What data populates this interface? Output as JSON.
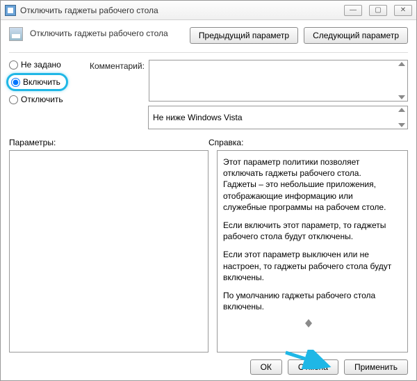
{
  "window": {
    "title": "Отключить гаджеты рабочего стола",
    "min_glyph": "—",
    "max_glyph": "▢",
    "close_glyph": "✕"
  },
  "header": {
    "title": "Отключить гаджеты рабочего стола",
    "prev": "Предыдущий параметр",
    "next": "Следующий параметр"
  },
  "radios": {
    "not_configured": "Не задано",
    "enabled": "Включить",
    "disabled": "Отключить",
    "selected": "enabled"
  },
  "comment": {
    "label": "Комментарий:",
    "value": ""
  },
  "supported": {
    "value": "Не ниже Windows Vista"
  },
  "sections": {
    "params": "Параметры:",
    "help": "Справка:"
  },
  "help": {
    "p1": "Этот параметр политики позволяет отключать гаджеты рабочего стола. Гаджеты – это небольшие приложения, отображающие информацию или служебные программы на рабочем столе.",
    "p2": "Если включить этот параметр, то гаджеты рабочего стола будут отключены.",
    "p3": "Если этот параметр выключен или не настроен, то гаджеты рабочего стола будут включены.",
    "p4": "По умолчанию гаджеты рабочего стола включены."
  },
  "footer": {
    "ok": "ОК",
    "cancel": "Отмена",
    "apply": "Применить"
  }
}
